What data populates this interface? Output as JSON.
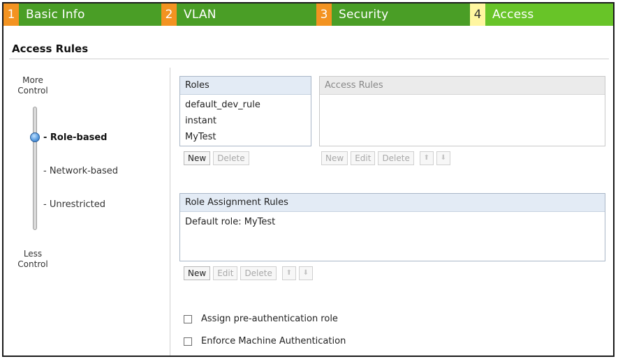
{
  "wizard_tabs": [
    {
      "num": "1",
      "label": "Basic Info"
    },
    {
      "num": "2",
      "label": "VLAN"
    },
    {
      "num": "3",
      "label": "Security"
    },
    {
      "num": "4",
      "label": "Access"
    }
  ],
  "active_tab": "4",
  "section_title": "Access Rules",
  "access_control": {
    "top_label_line1": "More",
    "top_label_line2": "Control",
    "bottom_label_line1": "Less",
    "bottom_label_line2": "Control",
    "options": [
      "- Role-based",
      "- Network-based",
      "- Unrestricted"
    ],
    "selected": "- Role-based"
  },
  "roles_list": {
    "header": "Roles",
    "items": [
      "default_dev_rule",
      "instant",
      "MyTest"
    ]
  },
  "access_rules_list": {
    "header": "Access Rules",
    "items": []
  },
  "role_assignment": {
    "header": "Role Assignment Rules",
    "items": [
      "Default role: MyTest"
    ]
  },
  "buttons": {
    "new": "New",
    "edit": "Edit",
    "delete": "Delete",
    "up_arrow": "⬆",
    "down_arrow": "⬇"
  },
  "checkboxes": [
    {
      "label": "Assign pre-authentication role",
      "checked": false
    },
    {
      "label": "Enforce Machine Authentication",
      "checked": false
    }
  ],
  "colors": {
    "tab_green": "#4a9e26",
    "tab_active_green": "#68c428",
    "tab_number_orange": "#f39321",
    "tab_active_number": "#fff6a0",
    "list_header_blue": "#e3ebf5"
  }
}
